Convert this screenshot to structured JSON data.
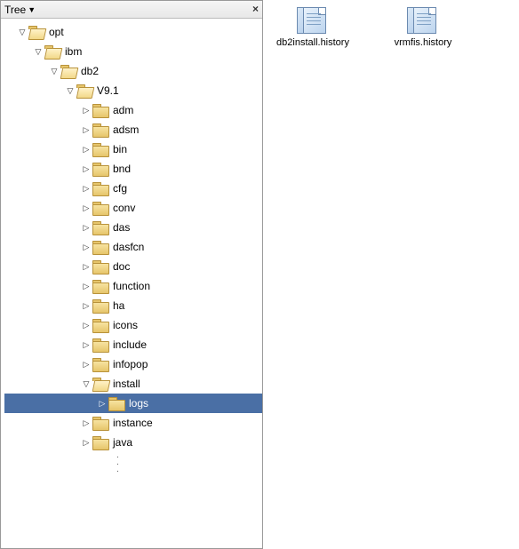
{
  "tree": {
    "title": "Tree",
    "nodes": [
      {
        "label": "opt",
        "depth": 0,
        "expanded": true,
        "hasChildren": true,
        "selected": false
      },
      {
        "label": "ibm",
        "depth": 1,
        "expanded": true,
        "hasChildren": true,
        "selected": false
      },
      {
        "label": "db2",
        "depth": 2,
        "expanded": true,
        "hasChildren": true,
        "selected": false
      },
      {
        "label": "V9.1",
        "depth": 3,
        "expanded": true,
        "hasChildren": true,
        "selected": false
      },
      {
        "label": "adm",
        "depth": 4,
        "expanded": false,
        "hasChildren": true,
        "selected": false
      },
      {
        "label": "adsm",
        "depth": 4,
        "expanded": false,
        "hasChildren": true,
        "selected": false
      },
      {
        "label": "bin",
        "depth": 4,
        "expanded": false,
        "hasChildren": true,
        "selected": false
      },
      {
        "label": "bnd",
        "depth": 4,
        "expanded": false,
        "hasChildren": true,
        "selected": false
      },
      {
        "label": "cfg",
        "depth": 4,
        "expanded": false,
        "hasChildren": true,
        "selected": false
      },
      {
        "label": "conv",
        "depth": 4,
        "expanded": false,
        "hasChildren": true,
        "selected": false
      },
      {
        "label": "das",
        "depth": 4,
        "expanded": false,
        "hasChildren": true,
        "selected": false
      },
      {
        "label": "dasfcn",
        "depth": 4,
        "expanded": false,
        "hasChildren": true,
        "selected": false
      },
      {
        "label": "doc",
        "depth": 4,
        "expanded": false,
        "hasChildren": true,
        "selected": false
      },
      {
        "label": "function",
        "depth": 4,
        "expanded": false,
        "hasChildren": true,
        "selected": false
      },
      {
        "label": "ha",
        "depth": 4,
        "expanded": false,
        "hasChildren": true,
        "selected": false
      },
      {
        "label": "icons",
        "depth": 4,
        "expanded": false,
        "hasChildren": true,
        "selected": false
      },
      {
        "label": "include",
        "depth": 4,
        "expanded": false,
        "hasChildren": true,
        "selected": false
      },
      {
        "label": "infopop",
        "depth": 4,
        "expanded": false,
        "hasChildren": true,
        "selected": false
      },
      {
        "label": "install",
        "depth": 4,
        "expanded": true,
        "hasChildren": true,
        "selected": false
      },
      {
        "label": "logs",
        "depth": 5,
        "expanded": false,
        "hasChildren": true,
        "selected": true
      },
      {
        "label": "instance",
        "depth": 4,
        "expanded": false,
        "hasChildren": true,
        "selected": false
      },
      {
        "label": "java",
        "depth": 4,
        "expanded": false,
        "hasChildren": true,
        "selected": false
      }
    ]
  },
  "files": [
    {
      "name": "db2install.history"
    },
    {
      "name": "vrmfis.history"
    }
  ],
  "colors": {
    "selection": "#4a6fa5"
  }
}
